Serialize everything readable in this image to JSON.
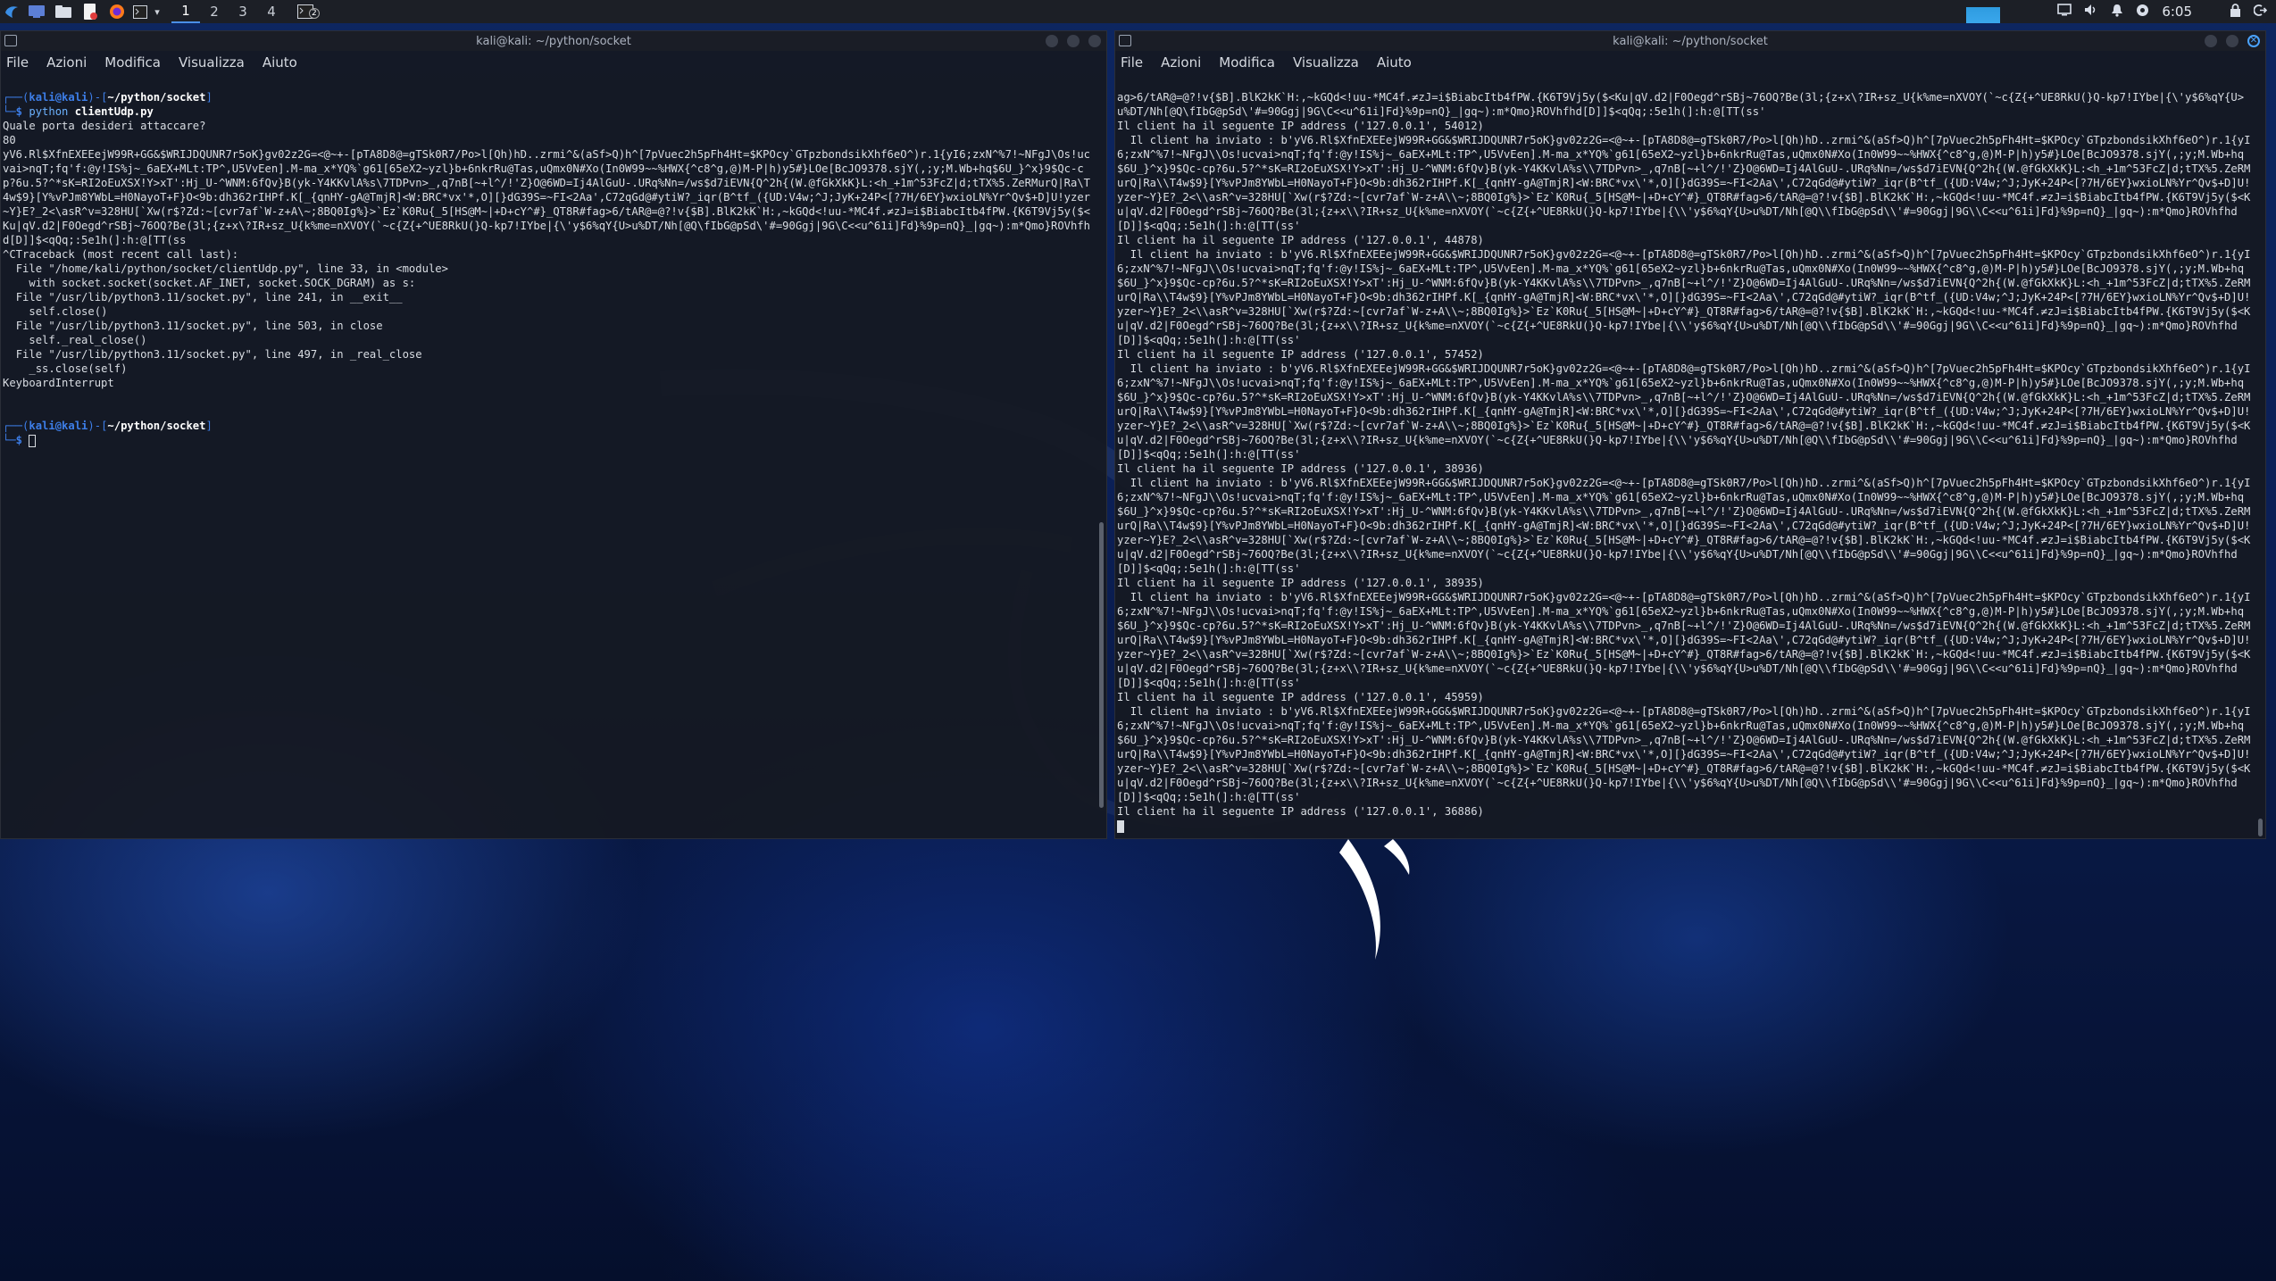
{
  "panel": {
    "workspaces": [
      "1",
      "2",
      "3",
      "4"
    ],
    "active_workspace": "1",
    "clock": "6:05",
    "badge": "2",
    "icons": [
      "kali-menu-icon",
      "desktop-icon",
      "file-manager-icon",
      "text-editor-icon",
      "firefox-icon",
      "terminal-icon",
      "dropdown-icon"
    ]
  },
  "left_terminal": {
    "title": "kali@kali: ~/python/socket",
    "menu": [
      "File",
      "Azioni",
      "Modifica",
      "Visualizza",
      "Aiuto"
    ],
    "prompt_user": "kali@kali",
    "prompt_path": "~/python/socket",
    "cmd_name": "python",
    "cmd_arg": "clientUdp.py",
    "output": "Quale porta desideri attaccare?\n80\nyV6.Rl$XfnEXEEejW99R+GG&$WRIJDQUNR7r5oK}gv02z2G=<@~+-[pTA8D8@=gTSk0R7/Po>l[Qh)hD..zrmi^&(aSf>Q)h^[7pVuec2h5pFh4Ht=$KPOcy`GTpzbondsikXhf6eO^)r.1{yI6;zxN^%7!~NFgJ\\Os!ucvai>nqT;fq'f:@y!IS%j~_6aEX+MLt:TP^,U5VvEen].M-ma_x*YQ%`g61[65eX2~yzl}b+6nkrRu@Tas,uQmx0N#Xo(In0W99~~%HWX{^c8^g,@)M-P|h)y5#}LOe[BcJO9378.sjY(,;y;M.Wb+hq$6U_}^x}9$Qc-cp?6u.5?^*sK=RI2oEuXSX!Y>xT':Hj_U-^WNM:6fQv}B(yk-Y4KKvlA%s\\7TDPvn>_,q7nB[~+l^/!'Z}O@6WD=Ij4AlGuU-.URq%Nn=/ws$d7iEVN{Q^2h{(W.@fGkXkK}L:<h_+1m^53FcZ|d;tTX%5.ZeRMurQ|Ra\\T4w$9}[Y%vPJm8YWbL=H0NayoT+F}O<9b:dh362rIHPf.K[_{qnHY-gA@TmjR]<W:BRC*vx'*,O][}dG39S=~FI<2Aa',C72qGd@#ytiW?_iqr(B^tf_({UD:V4w;^J;JyK+24P<[?7H/6EY}wxioLN%Yr^Qv$+D]U!yzer~Y}E?_2<\\asR^v=328HU[`Xw(r$?Zd:~[cvr7af`W-z+A\\~;8BQ0Ig%}>`Ez`K0Ru{_5[HS@M~|+D+cY^#}_QT8R#fag>6/tAR@=@?!v{$B].BlK2kK`H:,~kGQd<!uu-*MC4f.≠zJ=i$BiabcItb4fPW.{K6T9Vj5y($<Ku|qV.d2|F0Oegd^rSBj~76OQ?Be(3l;{z+x\\?IR+sz_U{k%me=nXVOY(`~c{Z{+^UE8RkU(}Q-kp7!IYbe|{\\'y$6%qY{U>u%DT/Nh[@Q\\fIbG@pSd\\'#=90Ggj|9G\\C<<u^61i]Fd}%9p=nQ}_|gq~):m*Qmo}ROVhfhd[D]]$<qQq;:5e1h(]:h:@[TT(ss\n^CTraceback (most recent call last):\n  File \"/home/kali/python/socket/clientUdp.py\", line 33, in <module>\n    with socket.socket(socket.AF_INET, socket.SOCK_DGRAM) as s:\n  File \"/usr/lib/python3.11/socket.py\", line 241, in __exit__\n    self.close()\n  File \"/usr/lib/python3.11/socket.py\", line 503, in close\n    self._real_close()\n  File \"/usr/lib/python3.11/socket.py\", line 497, in _real_close\n    _ss.close(self)\nKeyboardInterrupt"
  },
  "right_terminal": {
    "title": "kali@kali: ~/python/socket",
    "menu": [
      "File",
      "Azioni",
      "Modifica",
      "Visualizza",
      "Aiuto"
    ],
    "top_fragment": "ag>6/tAR@=@?!v{$B].BlK2kK`H:,~kGQd<!uu-*MC4f.≠zJ=i$BiabcItb4fPW.{K6T9Vj5y($<Ku|qV.d2|F0Oegd^rSBj~76OQ?Be(3l;{z+x\\?IR+sz_U{k%me=nXVOY(`~c{Z{+^UE8RkU(}Q-kp7!IYbe|{\\'y$6%qY{U>u%DT/Nh[@Q\\fIbG@pSd\\'#=90Ggj|9G\\C<<u^61i]Fd}%9p=nQ}_|gq~):m*Qmo}ROVhfhd[D]]$<qQq;:5e1h(]:h:@[TT(ss'",
    "received_prefix": "  Il client ha inviato : ",
    "payload": "b'yV6.Rl$XfnEXEEejW99R+GG&$WRIJDQUNR7r5oK}gv02z2G=<@~+-[pTA8D8@=gTSk0R7/Po>l[Qh)hD..zrmi^&(aSf>Q)h^[7pVuec2h5pFh4Ht=$KPOcy`GTpzbondsikXhf6eO^)r.1{yI6;zxN^%7!~NFgJ\\\\Os!ucvai>nqT;fq'f:@y!IS%j~_6aEX+MLt:TP^,U5VvEen].M-ma_x*YQ%`g61[65eX2~yzl}b+6nkrRu@Tas,uQmx0N#Xo(In0W99~~%HWX{^c8^g,@)M-P|h)y5#}LOe[BcJO9378.sjY(,;y;M.Wb+hq$6U_}^x}9$Qc-cp?6u.5?^*sK=RI2oEuXSX!Y>xT':Hj_U-^WNM:6fQv}B(yk-Y4KKvlA%s\\\\7TDPvn>_,q7nB[~+l^/!'Z}O@6WD=Ij4AlGuU-.URq%Nn=/ws$d7iEVN{Q^2h{(W.@fGkXkK}L:<h_+1m^53FcZ|d;tTX%5.ZeRMurQ|Ra\\\\T4w$9}[Y%vPJm8YWbL=H0NayoT+F}O<9b:dh362rIHPf.K[_{qnHY-gA@TmjR]<W:BRC*vx\\'*,O][}dG39S=~FI<2Aa\\',C72qGd@#ytiW?_iqr(B^tf_({UD:V4w;^J;JyK+24P<[?7H/6EY}wxioLN%Yr^Qv$+D]U!yzer~Y}E?_2<\\\\asR^v=328HU[`Xw(r$?Zd:~[cvr7af`W-z+A\\\\~;8BQ0Ig%}>`Ez`K0Ru{_5[HS@M~|+D+cY^#}_QT8R#fag>6/tAR@=@?!v{$B].BlK2kK`H:,~kGQd<!uu-*MC4f.≠zJ=i$BiabcItb4fPW.{K6T9Vj5y($<Ku|qV.d2|F0Oegd^rSBj~76OQ?Be(3l;{z+x\\\\?IR+sz_U{k%me=nXVOY(`~c{Z{+^UE8RkU(}Q-kp7!IYbe|{\\\\'y$6%qY{U>u%DT/Nh[@Q\\\\fIbG@pSd\\\\'#=90Ggj|9G\\\\C<<u^61i]Fd}%9p=nQ}_|gq~):m*Qmo}ROVhfhd[D]]$<qQq;:5e1h(]:h:@[TT(ss'",
    "ip_lines": [
      "Il client ha il seguente IP address ('127.0.0.1', 54012)",
      "Il client ha il seguente IP address ('127.0.0.1', 44878)",
      "Il client ha il seguente IP address ('127.0.0.1', 57452)",
      "Il client ha il seguente IP address ('127.0.0.1', 38936)",
      "Il client ha il seguente IP address ('127.0.0.1', 38935)",
      "Il client ha il seguente IP address ('127.0.0.1', 45959)",
      "Il client ha il seguente IP address ('127.0.0.1', 36886)"
    ]
  }
}
